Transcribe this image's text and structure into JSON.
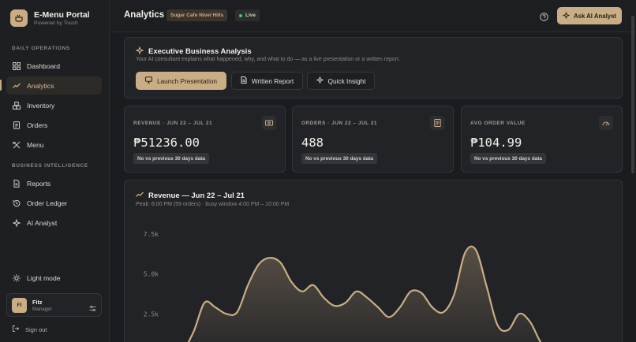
{
  "brand": {
    "title": "E-Menu Portal",
    "subtitle": "Powered by Touch"
  },
  "sidebar": {
    "sections": [
      {
        "label": "DAILY OPERATIONS"
      },
      {
        "label": "BUSINESS INTELLIGENCE"
      }
    ],
    "items": [
      {
        "label": "Dashboard",
        "icon": "grid-icon"
      },
      {
        "label": "Analytics",
        "icon": "trend-icon",
        "active": true
      },
      {
        "label": "Inventory",
        "icon": "boxes-icon"
      },
      {
        "label": "Orders",
        "icon": "clipboard-icon"
      },
      {
        "label": "Menu",
        "icon": "utensils-icon"
      },
      {
        "label": "Reports",
        "icon": "document-icon"
      },
      {
        "label": "Order Ledger",
        "icon": "history-icon"
      },
      {
        "label": "AI Analyst",
        "icon": "sparkles-icon"
      }
    ],
    "theme_toggle": "Light mode",
    "user": {
      "initials": "FI",
      "name": "Fitz",
      "role": "Manager"
    },
    "signout": "Sign out"
  },
  "topbar": {
    "title": "Analytics",
    "location": "Sugar Cafe Nivel Hills",
    "live": "Live",
    "ask_button": "Ask AI Analyst"
  },
  "exec": {
    "title": "Executive Business Analysis",
    "subtitle": "Your AI consultant explains what happened, why, and what to do — as a live presentation or a written report.",
    "buttons": [
      "Launch Presentation",
      "Written Report",
      "Quick Insight"
    ]
  },
  "stats": [
    {
      "label": "REVENUE · JUN 22 – JUL 21",
      "value": "₱51236.00",
      "chip": "No vs previous 30 days data",
      "icon": "cash-icon"
    },
    {
      "label": "ORDERS · JUN 22 – JUL 21",
      "value": "488",
      "chip": "No vs previous 30 days data",
      "icon": "receipt-icon"
    },
    {
      "label": "AVG ORDER VALUE",
      "value": "₱104.99",
      "chip": "No vs previous 30 days data",
      "icon": "gauge-icon"
    }
  ],
  "revenue": {
    "title": "Revenue — Jun 22 – Jul 21",
    "subtitle": "Peak: 6:00 PM (59 orders) · busy window 4:00 PM – 10:00 PM"
  },
  "colors": {
    "accent": "#c9ad85",
    "background": "#1b1c1f",
    "card": "#222326",
    "live": "#53c06a"
  },
  "chart_data": {
    "type": "area",
    "title": "Revenue — Jun 22 – Jul 21",
    "y_tick_labels": [
      "7.5k",
      "5.0k",
      "2.5k"
    ],
    "ylim": [
      0,
      8500
    ],
    "x": [
      0,
      0.2,
      0.4,
      0.6,
      0.8,
      1.0,
      1.2,
      1.4,
      1.6,
      1.8,
      2.0,
      2.2,
      2.4,
      2.6,
      2.8,
      3.0,
      3.2,
      3.4,
      3.6,
      3.8,
      4.0,
      4.2,
      4.4,
      4.6,
      4.8,
      5.0,
      5.2,
      5.4,
      5.6,
      5.8,
      6.0,
      6.2,
      6.4,
      6.6,
      6.8,
      7.0,
      7.2,
      7.4,
      7.6,
      7.8,
      8.0
    ],
    "values": [
      0,
      200,
      1400,
      3200,
      2900,
      2500,
      2600,
      4300,
      5600,
      6000,
      5700,
      4500,
      3900,
      4300,
      3500,
      3000,
      3200,
      3900,
      3500,
      2900,
      2300,
      2900,
      3900,
      3800,
      2900,
      2600,
      3700,
      6300,
      6500,
      4200,
      1800,
      1500,
      2500,
      2000,
      700,
      0,
      0,
      0,
      0,
      0,
      0
    ],
    "grid": false,
    "legend": "none"
  }
}
